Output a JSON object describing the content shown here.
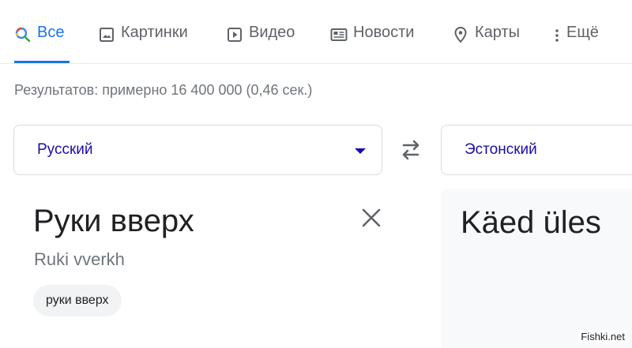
{
  "tabs": [
    {
      "label": "Все",
      "icon": "search-icon",
      "active": true
    },
    {
      "label": "Картинки",
      "icon": "image-icon"
    },
    {
      "label": "Видео",
      "icon": "video-icon"
    },
    {
      "label": "Новости",
      "icon": "news-icon"
    },
    {
      "label": "Карты",
      "icon": "map-pin-icon"
    },
    {
      "label": "Ещё",
      "icon": "more-vert-icon"
    }
  ],
  "stats": "Результатов: примерно 16 400 000 (0,46 сек.)",
  "translator": {
    "source_lang": "Русский",
    "target_lang": "Эстонский",
    "source_text": "Руки вверх",
    "transliteration": "Ruki vverkh",
    "suggestion_chip": "руки вверх",
    "translation": "Käed üles"
  },
  "watermark": "Fishki.net",
  "colors": {
    "accent": "#1a73e8",
    "link": "#1a0dab",
    "muted": "#70757a"
  }
}
